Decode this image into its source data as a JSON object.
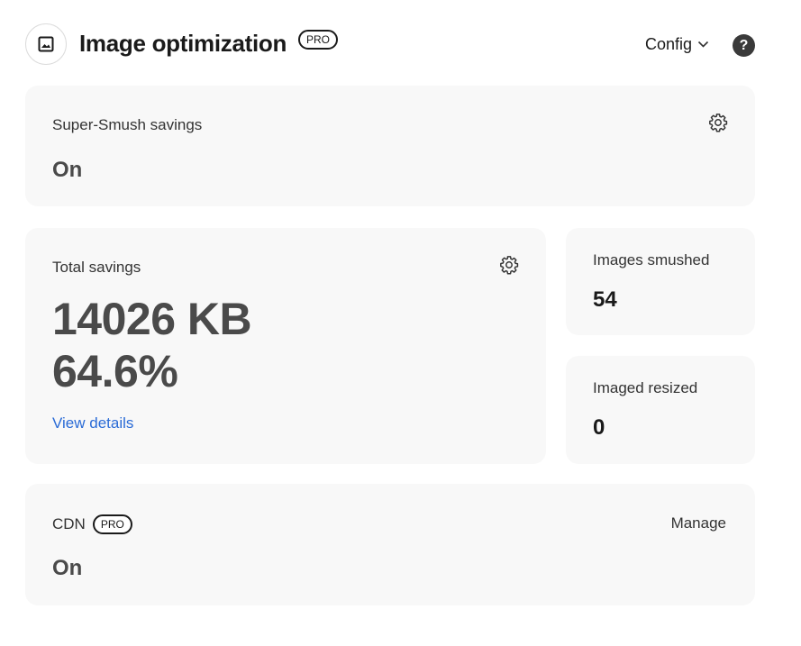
{
  "header": {
    "title": "Image optimization",
    "badge": "PRO",
    "config_label": "Config",
    "help_label": "?"
  },
  "super_smush": {
    "label": "Super-Smush savings",
    "value": "On"
  },
  "total_savings": {
    "label": "Total savings",
    "size": "14026 KB",
    "percent": "64.6%",
    "link": "View details"
  },
  "images_smushed": {
    "label": "Images smushed",
    "value": "54"
  },
  "images_resized": {
    "label": "Imaged resized",
    "value": "0"
  },
  "cdn": {
    "label": "CDN",
    "badge": "PRO",
    "manage_label": "Manage",
    "value": "On"
  }
}
